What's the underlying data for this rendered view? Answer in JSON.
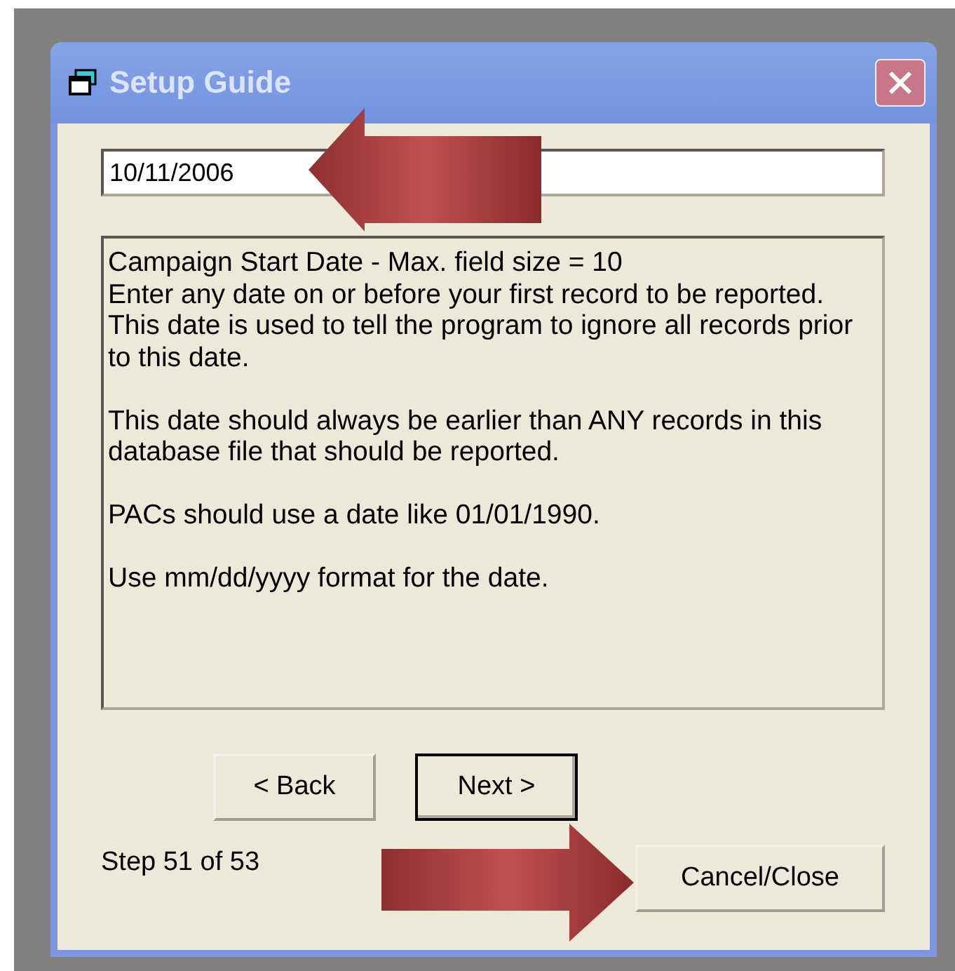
{
  "window": {
    "title": "Setup Guide"
  },
  "date_field": {
    "value": "10/11/2006"
  },
  "help_text": [
    "Campaign Start Date - Max. field size = 10\nEnter any date on or before your first record to be reported. This date is used to tell the program to ignore all records prior to this date.",
    "This date should always be earlier than ANY records in this database file that should be reported.",
    "PACs should use a date like 01/01/1990.",
    "Use mm/dd/yyyy format for the date."
  ],
  "nav_buttons": [
    {
      "label": "< Back",
      "default": false
    },
    {
      "label": "Next >",
      "default": true
    }
  ],
  "step": "Step 51 of 53",
  "cancel_button": {
    "label": "Cancel/Close"
  }
}
